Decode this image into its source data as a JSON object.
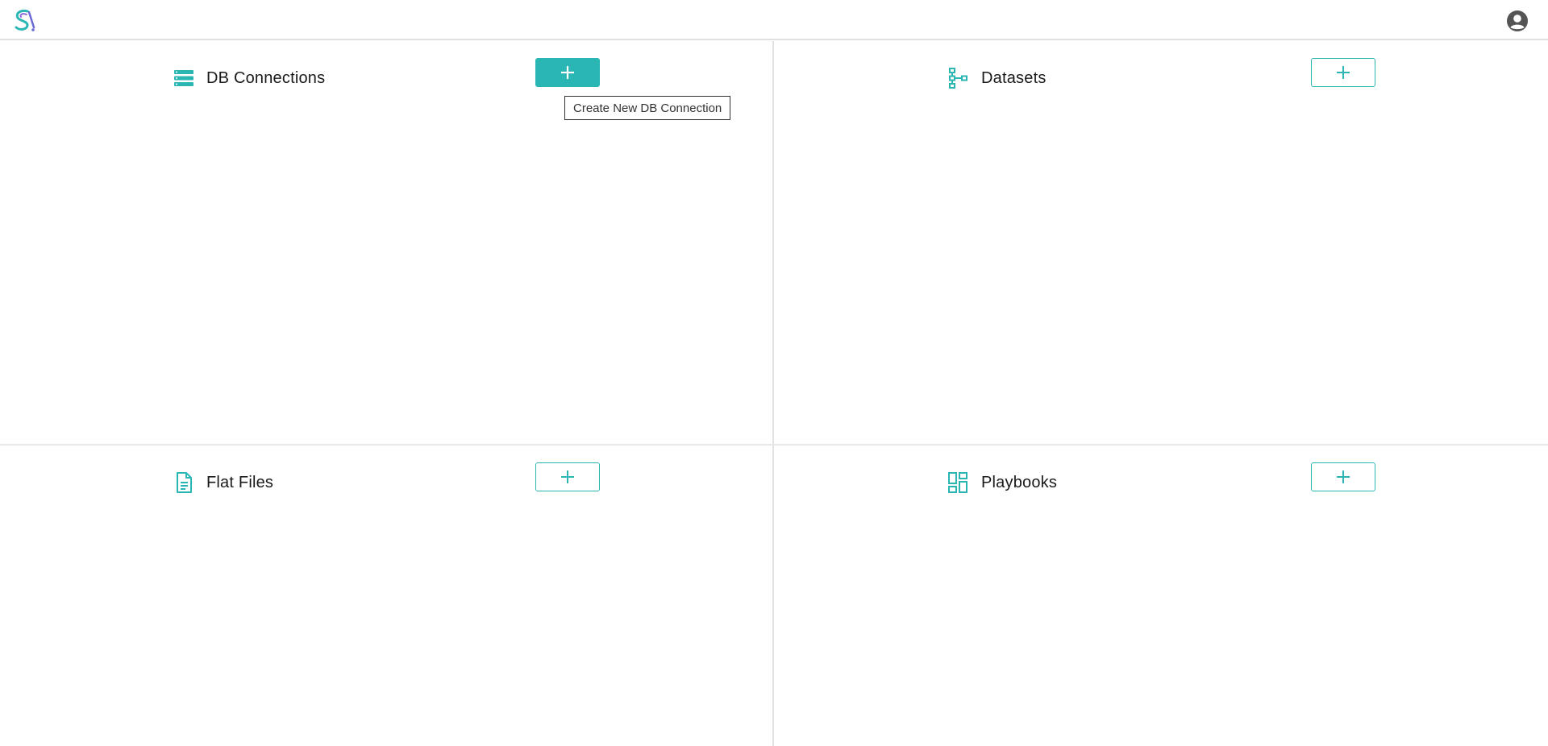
{
  "app": {
    "logo_icon": "app-logo-icon",
    "account_icon": "user-account-icon"
  },
  "colors": {
    "accent": "#2ab7b4",
    "divider": "#e2e2e2"
  },
  "panels": {
    "db_connections": {
      "title": "DB Connections",
      "icon": "database-stack-icon",
      "add_tooltip": "Create New DB Connection"
    },
    "datasets": {
      "title": "Datasets",
      "icon": "hierarchy-tree-icon"
    },
    "flat_files": {
      "title": "Flat Files",
      "icon": "document-icon"
    },
    "playbooks": {
      "title": "Playbooks",
      "icon": "dashboard-grid-icon"
    }
  }
}
